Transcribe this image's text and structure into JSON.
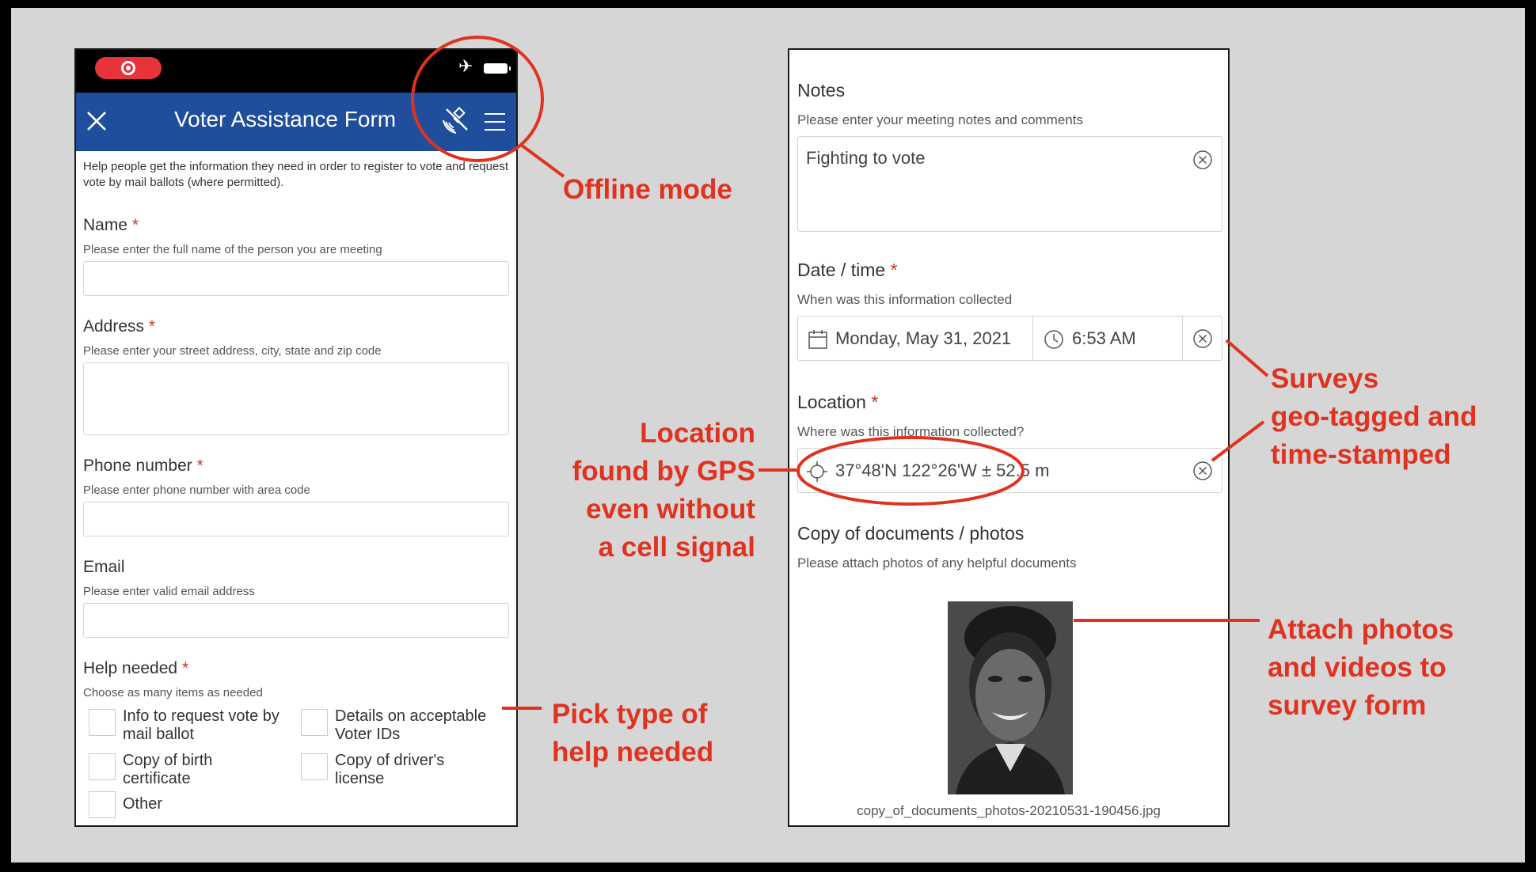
{
  "left_form": {
    "title": "Voter Assistance Form",
    "description": "Help people get the information they need in order to register to vote and request vote by mail ballots (where permitted).",
    "fields": {
      "name": {
        "label": "Name",
        "hint": "Please enter the full name of the person you are meeting"
      },
      "address": {
        "label": "Address",
        "hint": "Please enter your street address, city, state and zip code"
      },
      "phone": {
        "label": "Phone number",
        "hint": "Please enter phone number with area code"
      },
      "email": {
        "label": "Email",
        "hint": "Please enter valid email address"
      },
      "help": {
        "label": "Help needed",
        "hint": "Choose as many items as needed"
      }
    },
    "required_mark": "*",
    "help_options": [
      "Info to request vote by mail ballot",
      "Details on acceptable Voter IDs",
      "Copy of birth certificate",
      "Copy of driver's license",
      "Other"
    ]
  },
  "right_form": {
    "notes": {
      "label": "Notes",
      "hint": "Please enter your meeting notes and comments",
      "value": "Fighting to vote"
    },
    "datetime": {
      "label": "Date / time",
      "hint": "When was this information collected",
      "date": "Monday, May 31, 2021",
      "time": "6:53 AM"
    },
    "location": {
      "label": "Location",
      "hint": "Where was this information collected?",
      "value": "37°48'N 122°26'W ± 52.5 m"
    },
    "photos": {
      "label": "Copy of documents / photos",
      "hint": "Please attach photos of any helpful documents",
      "filename": "copy_of_documents_photos-20210531-190456.jpg"
    }
  },
  "annotations": {
    "offline": "Offline mode",
    "pick_help": [
      "Pick type of",
      "help needed"
    ],
    "gps": [
      "Location",
      "found by GPS",
      "even without",
      "a cell signal"
    ],
    "geotag": [
      "Surveys",
      "geo-tagged and",
      "time-stamped"
    ],
    "attach": [
      "Attach photos",
      "and videos to",
      "survey form"
    ]
  },
  "colors": {
    "header": "#1f4f9c",
    "annotation": "#e0321f",
    "required": "#c0392b",
    "record": "#e8333a"
  }
}
